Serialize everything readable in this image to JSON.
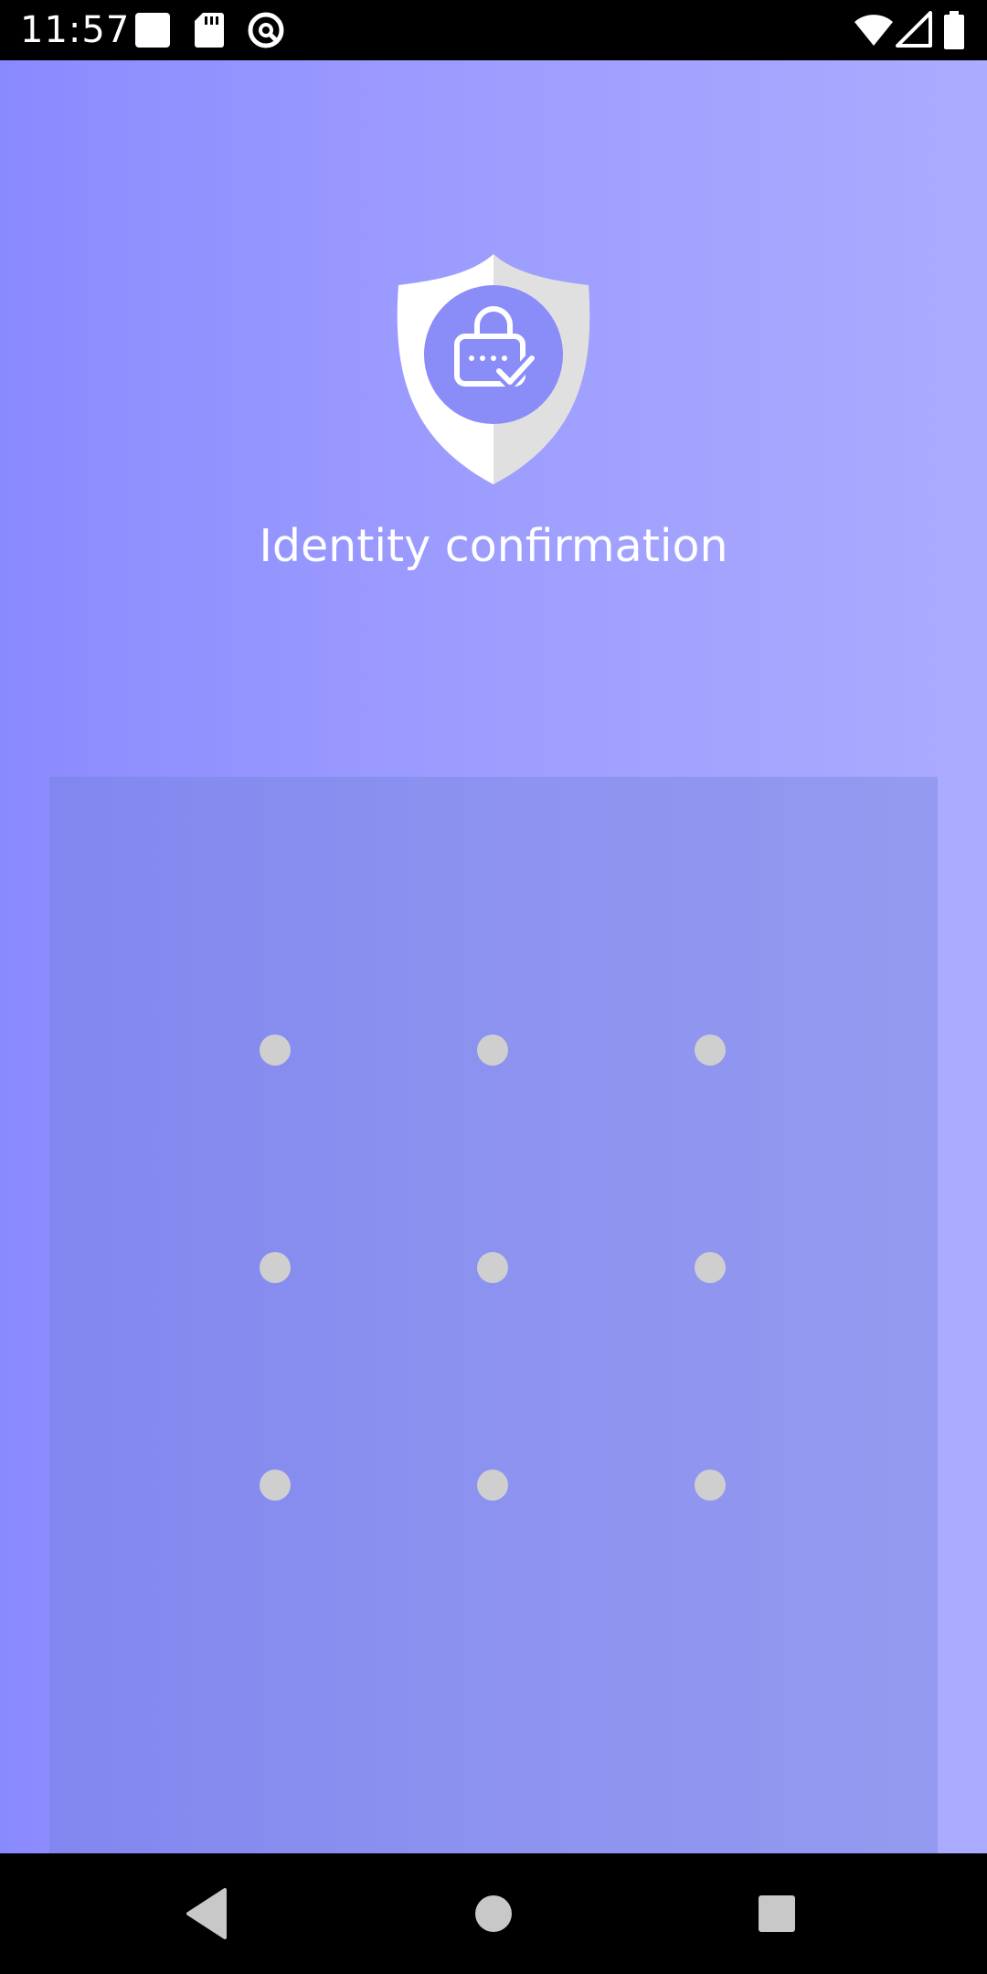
{
  "status_bar": {
    "time": "11:57",
    "left_icons": [
      "square-notification-icon",
      "sd-card-icon",
      "at-sign-icon"
    ],
    "right_icons": [
      "wifi-icon",
      "cell-signal-icon",
      "battery-icon"
    ]
  },
  "header": {
    "icon": "shield-lock-icon",
    "title": "Identity confirmation"
  },
  "pattern_lock": {
    "rows": 3,
    "cols": 3,
    "dot_color": "#cfcfcf"
  },
  "nav_bar": {
    "buttons": [
      "back-icon",
      "home-icon",
      "recents-icon"
    ]
  },
  "colors": {
    "accent": "#8a8aff",
    "background_end": "#ababff",
    "title_text": "#ffffff"
  }
}
